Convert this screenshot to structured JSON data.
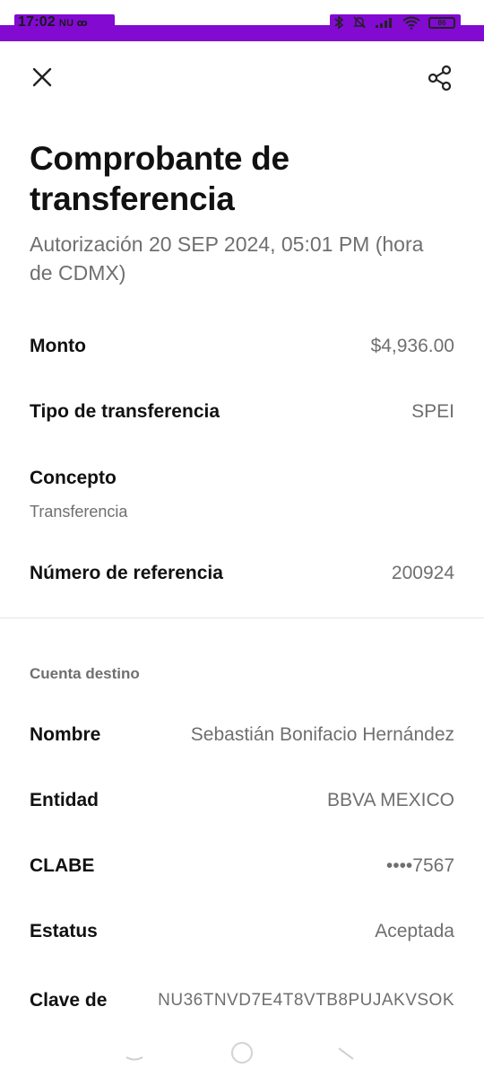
{
  "status_bar": {
    "time": "17:02",
    "left_icons": [
      "nu-icon",
      "voicemail-icon"
    ],
    "left_icons_text": "NU ꝏ",
    "right_icons": [
      "bluetooth-icon",
      "mute-icon",
      "signal-icon",
      "wifi-icon",
      "battery-icon"
    ],
    "battery_level": "86"
  },
  "header": {
    "close_icon": "close-icon",
    "share_icon": "share-icon"
  },
  "receipt": {
    "title": "Comprobante de transferencia",
    "subtitle": "Autorización 20 SEP 2024, 05:01 PM (hora de CDMX)",
    "details": {
      "monto_label": "Monto",
      "monto_value": "$4,936.00",
      "tipo_label": "Tipo de transferencia",
      "tipo_value": "SPEI",
      "concepto_label": "Concepto",
      "concepto_value": "Transferencia",
      "referencia_label": "Número de referencia",
      "referencia_value": "200924"
    },
    "destination": {
      "section_label": "Cuenta destino",
      "nombre_label": "Nombre",
      "nombre_value": "Sebastián Bonifacio Hernández",
      "entidad_label": "Entidad",
      "entidad_value": "BBVA MEXICO",
      "clabe_label": "CLABE",
      "clabe_value": "••••7567",
      "estatus_label": "Estatus",
      "estatus_value": "Aceptada",
      "clave_label": "Clave de",
      "clave_value": "NU36TNVD7E4T8VTB8PUJAKVSOK"
    }
  },
  "navigation_bar": {
    "items": [
      "menu-icon",
      "home-icon",
      "back-icon"
    ]
  },
  "colors": {
    "brand": "#820ad1",
    "text_primary": "#111111",
    "text_secondary": "#6f6f6f",
    "divider": "#e5e5e5"
  }
}
